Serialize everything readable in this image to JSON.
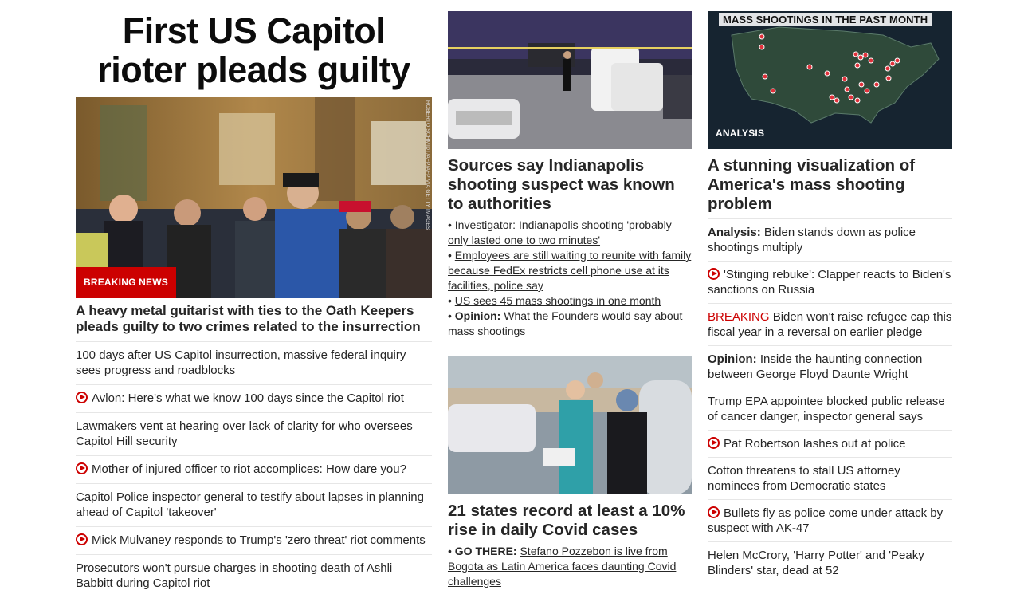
{
  "colors": {
    "accent": "#cc0000",
    "text": "#262626",
    "divider": "#e6e6e6"
  },
  "col1": {
    "headline": "First US Capitol rioter pleads guilty",
    "image_badge": "BREAKING NEWS",
    "photo_credit": "ROBERTO SCHMIDT/AFP/AFP VIA GETTY IMAGES",
    "story_title": "A heavy metal guitarist with ties to the Oath Keepers pleads guilty to two crimes related to the insurrection",
    "links": [
      {
        "text": "100 days after US Capitol insurrection, massive federal inquiry sees progress and roadblocks",
        "video": false
      },
      {
        "text": "Avlon: Here's what we know 100 days since the Capitol riot",
        "video": true
      },
      {
        "text": "Lawmakers vent at hearing over lack of clarity for who oversees Capitol Hill security",
        "video": false
      },
      {
        "text": "Mother of injured officer to riot accomplices: How dare you?",
        "video": true
      },
      {
        "text": "Capitol Police inspector general to testify about lapses in planning ahead of Capitol 'takeover'",
        "video": false
      },
      {
        "text": "Mick Mulvaney responds to Trump's 'zero threat' riot comments",
        "video": true
      },
      {
        "text": "Prosecutors won't pursue charges in shooting death of Ashli Babbitt during Capitol riot",
        "video": false
      }
    ]
  },
  "col2": {
    "story1": {
      "title": "Sources say Indianapolis shooting suspect was known to authorities",
      "bullets": [
        {
          "kicker": "",
          "text": "Investigator: Indianapolis shooting 'probably only lasted one to two minutes'"
        },
        {
          "kicker": "",
          "text": "Employees are still waiting to reunite with family because FedEx restricts cell phone use at its facilities, police say"
        },
        {
          "kicker": "",
          "text": "US sees 45 mass shootings in one month"
        },
        {
          "kicker": "Opinion:",
          "text": "What the Founders would say about mass shootings"
        }
      ]
    },
    "story2": {
      "title": "21 states record at least a 10% rise in daily Covid cases",
      "bullets": [
        {
          "kicker": "GO THERE:",
          "text": "Stefano Pozzebon is live from Bogota as Latin America faces daunting Covid challenges"
        }
      ]
    }
  },
  "col3": {
    "map_title": "MASS SHOOTINGS IN THE PAST MONTH",
    "image_badge": "ANALYSIS",
    "story_title": "A stunning visualization of America's mass shooting problem",
    "links": [
      {
        "kicker": "Analysis:",
        "kicker_style": "bold",
        "text": "Biden stands down as police shootings multiply",
        "video": false
      },
      {
        "kicker": "",
        "kicker_style": "",
        "text": "'Stinging rebuke': Clapper reacts to Biden's sanctions on Russia",
        "video": true
      },
      {
        "kicker": "BREAKING",
        "kicker_style": "red",
        "text": "Biden won't raise refugee cap this fiscal year in a reversal on earlier pledge",
        "video": false
      },
      {
        "kicker": "Opinion:",
        "kicker_style": "bold",
        "text": "Inside the haunting connection between George Floyd Daunte Wright",
        "video": false
      },
      {
        "kicker": "",
        "kicker_style": "",
        "text": "Trump EPA appointee blocked public release of cancer danger, inspector general says",
        "video": false
      },
      {
        "kicker": "",
        "kicker_style": "",
        "text": "Pat Robertson lashes out at police",
        "video": true
      },
      {
        "kicker": "",
        "kicker_style": "",
        "text": "Cotton threatens to stall US attorney nominees from Democratic states",
        "video": false
      },
      {
        "kicker": "",
        "kicker_style": "",
        "text": "Bullets fly as police come under attack by suspect with AK-47",
        "video": true
      },
      {
        "kicker": "",
        "kicker_style": "",
        "text": "Helen McCrory, 'Harry Potter' and 'Peaky Blinders' star, dead at 52",
        "video": false
      }
    ]
  }
}
